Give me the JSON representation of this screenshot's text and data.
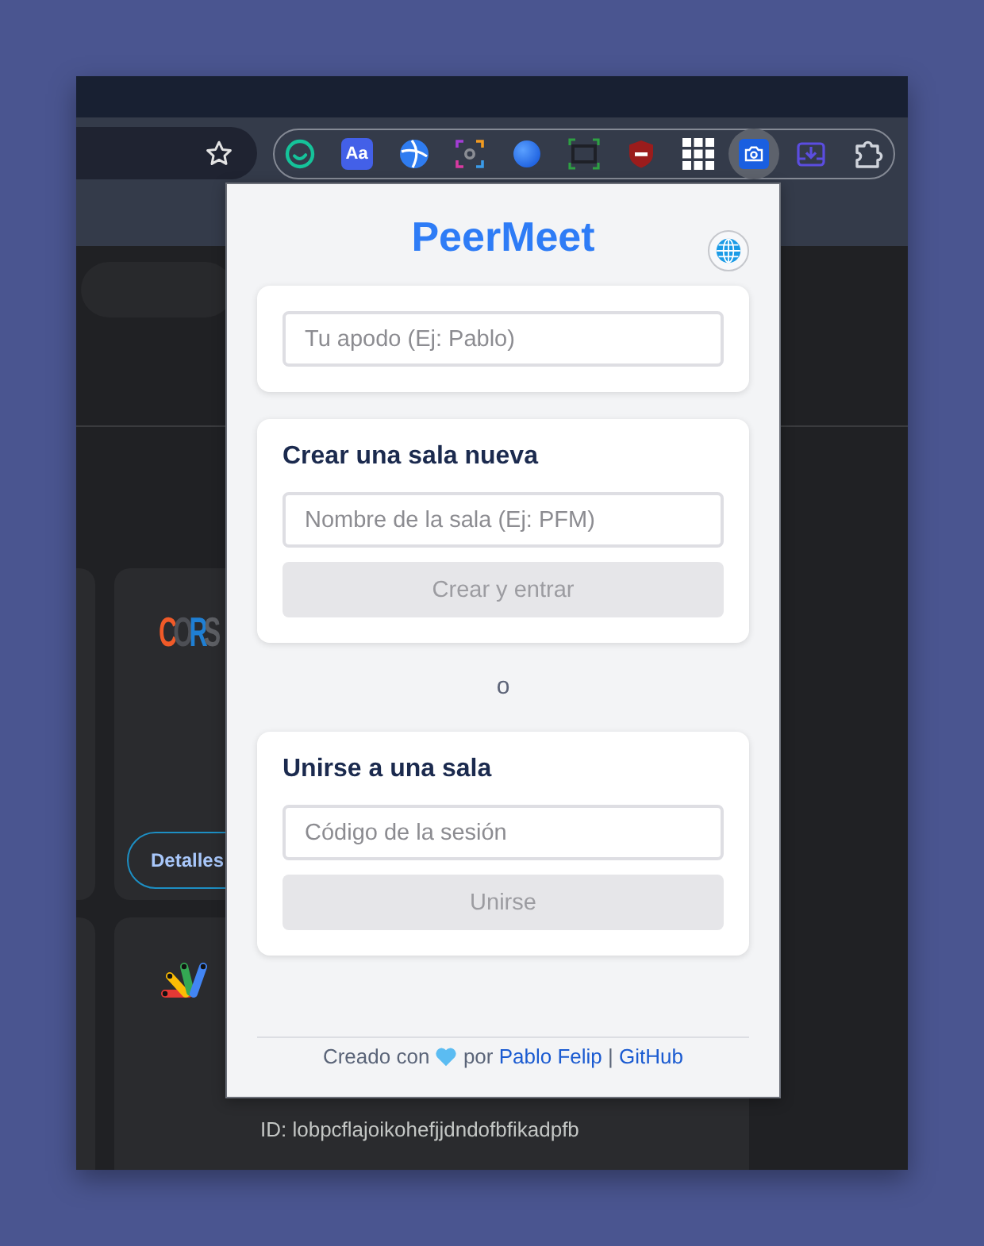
{
  "browser": {
    "extensions": [
      {
        "kind": "ring",
        "active": false
      },
      {
        "kind": "letters",
        "text": "Aa",
        "active": false
      },
      {
        "kind": "ball",
        "active": false
      },
      {
        "kind": "scan",
        "active": false
      },
      {
        "kind": "dot",
        "active": false
      },
      {
        "kind": "frame",
        "active": false
      },
      {
        "kind": "shield",
        "active": false
      },
      {
        "kind": "grid",
        "active": false
      },
      {
        "kind": "camera",
        "active": true
      },
      {
        "kind": "tray",
        "active": false
      },
      {
        "kind": "puzzle",
        "active": false
      }
    ]
  },
  "page": {
    "cards": [
      {
        "kind": "logo",
        "logo_text": "CORS",
        "button": "Detalles"
      },
      {
        "kind": "fan",
        "id_line": "ID: lobpcflajoikohefjjdndofbfikadpfb"
      }
    ]
  },
  "popup": {
    "title": "PeerMeet",
    "nickname": {
      "placeholder": "Tu apodo (Ej: Pablo)"
    },
    "create_room": {
      "heading": "Crear una sala nueva",
      "placeholder": "Nombre de la sala (Ej: PFM)",
      "button": {
        "label": "Crear y entrar",
        "disabled": true
      }
    },
    "separator": "o",
    "join_room": {
      "heading": "Unirse a una sala",
      "placeholder": "Código de la sesión",
      "button": {
        "label": "Unirse",
        "disabled": true
      }
    },
    "footer": {
      "before_icon": "Creado con",
      "after_icon": "por",
      "author_link": "Pablo Felip",
      "divider": "|",
      "repo_link": "GitHub"
    }
  }
}
